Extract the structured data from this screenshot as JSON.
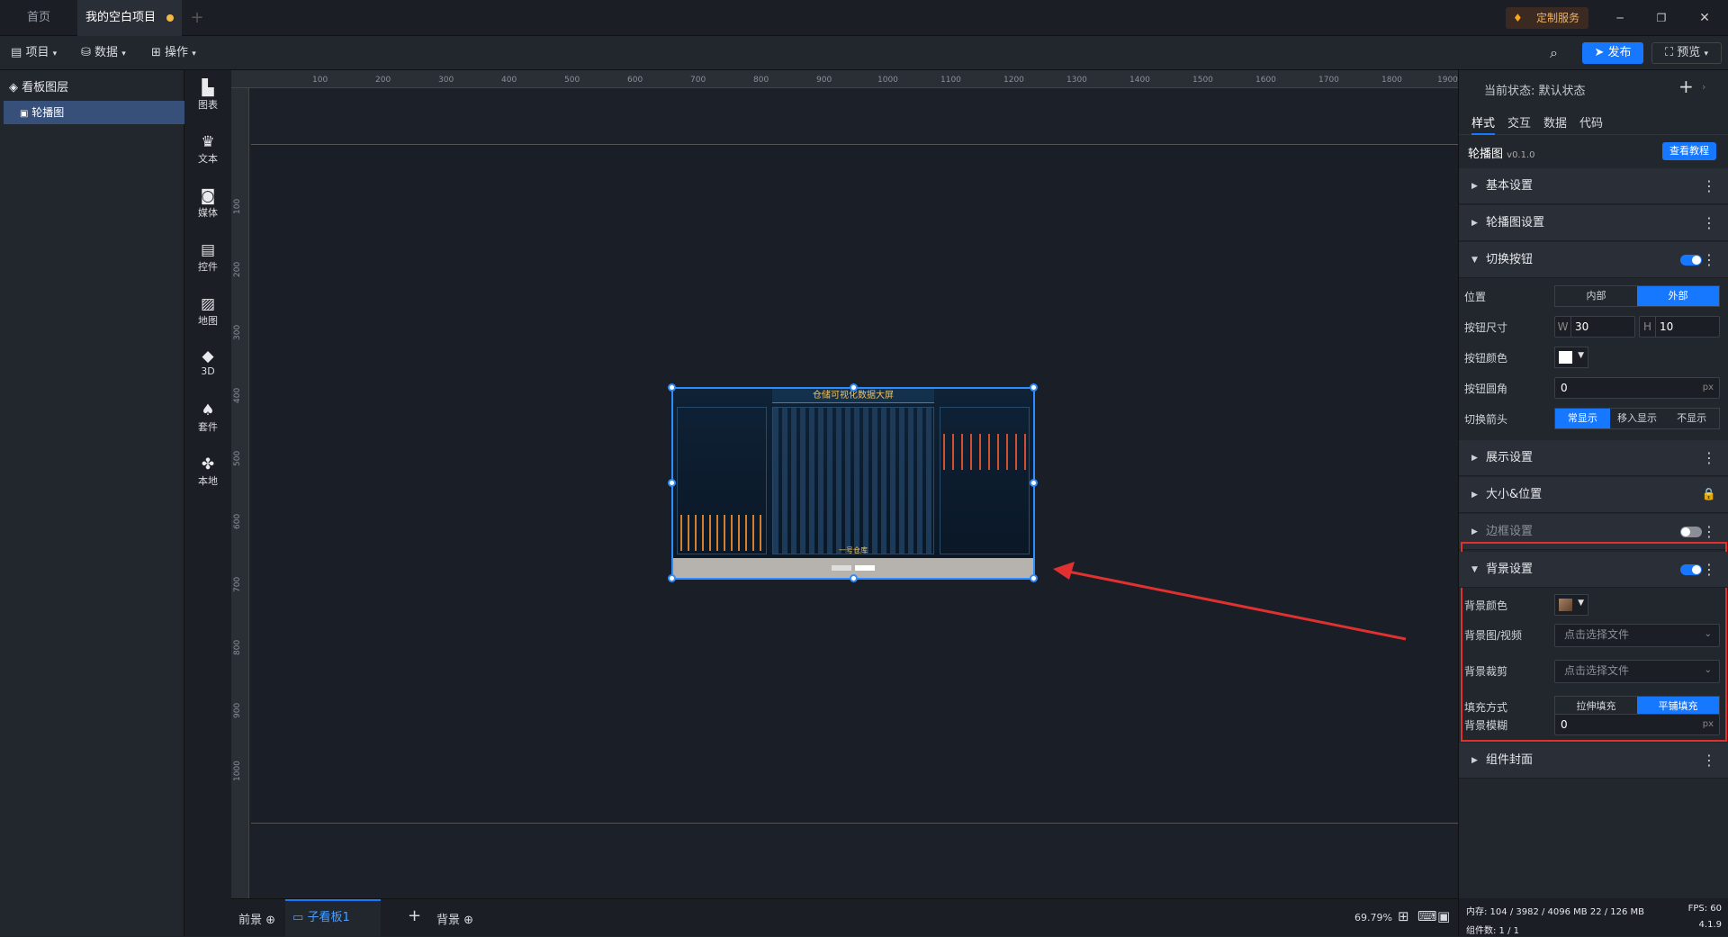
{
  "tabs": {
    "home": "首页",
    "project": "我的空白项目",
    "add": "+"
  },
  "window": {
    "custom_service": "定制服务",
    "minimize": "─",
    "restore": "❐",
    "close": "✕"
  },
  "toolbar": {
    "project": "项目",
    "data": "数据",
    "operate": "操作",
    "publish": "发布",
    "preview": "预览"
  },
  "layers": {
    "title": "看板图层",
    "items": [
      {
        "label": "轮播图"
      }
    ]
  },
  "iconbar": [
    {
      "label": "图表",
      "icon": "chart-icon"
    },
    {
      "label": "文本",
      "icon": "text-icon"
    },
    {
      "label": "媒体",
      "icon": "media-icon"
    },
    {
      "label": "控件",
      "icon": "control-icon"
    },
    {
      "label": "地图",
      "icon": "map-icon"
    },
    {
      "label": "3D",
      "icon": "cube-icon"
    },
    {
      "label": "套件",
      "icon": "kit-icon"
    },
    {
      "label": "本地",
      "icon": "puzzle-icon"
    }
  ],
  "ruler": {
    "top": [
      "100",
      "200",
      "300",
      "400",
      "500",
      "600",
      "700",
      "800",
      "900",
      "1000",
      "1100",
      "1200",
      "1300",
      "1400",
      "1500",
      "1600",
      "1700",
      "1800",
      "1900"
    ],
    "left": [
      "100",
      "200",
      "300",
      "400",
      "500",
      "600",
      "700",
      "800",
      "900",
      "1000"
    ]
  },
  "widget_preview": {
    "title": "仓储可视化数据大屏",
    "footer": "一号仓库"
  },
  "bottom": {
    "front": "前景",
    "sub_board": "子看板1",
    "back": "背景",
    "zoom": "69.79%"
  },
  "right": {
    "state_label": "当前状态: 默认状态",
    "tabs": [
      "样式",
      "交互",
      "数据",
      "代码"
    ],
    "component": "轮播图",
    "version": "v0.1.0",
    "tutorial": "查看教程",
    "sections": {
      "basic": "基本设置",
      "carousel": "轮播图设置",
      "switch_button": "切换按钮",
      "display": "展示设置",
      "size_pos": "大小&位置",
      "border": "边框设置",
      "background": "背景设置",
      "cover": "组件封面"
    },
    "switch_rows": {
      "position": {
        "label": "位置",
        "options": [
          "内部",
          "外部"
        ],
        "selected": "外部"
      },
      "button_size": {
        "label": "按钮尺寸",
        "w_label": "W",
        "w": "30",
        "h_label": "H",
        "h": "10"
      },
      "button_color": {
        "label": "按钮颜色",
        "color": "#ffffff"
      },
      "button_radius": {
        "label": "按钮圆角",
        "value": "0",
        "unit": "px"
      },
      "arrow": {
        "label": "切换箭头",
        "options": [
          "常显示",
          "移入显示",
          "不显示"
        ],
        "selected": "常显示"
      }
    },
    "bg_rows": {
      "color": {
        "label": "背景颜色",
        "color": "#8a6a4a"
      },
      "image": {
        "label": "背景图/视频",
        "placeholder": "点击选择文件"
      },
      "crop": {
        "label": "背景裁剪",
        "placeholder": "点击选择文件"
      },
      "fill": {
        "label": "填充方式",
        "options": [
          "拉伸填充",
          "平铺填充"
        ],
        "selected": "平铺填充"
      },
      "blur": {
        "label": "背景模糊",
        "value": "0",
        "unit": "px"
      }
    }
  },
  "status": {
    "memory": "内存: 104 / 3982 / 4096 MB 22 / 126 MB",
    "fps": "FPS: 60",
    "count": "组件数: 1 / 1",
    "version": "4.1.9"
  },
  "colors": {
    "accent": "#1677ff",
    "highlight": "#e03030"
  }
}
